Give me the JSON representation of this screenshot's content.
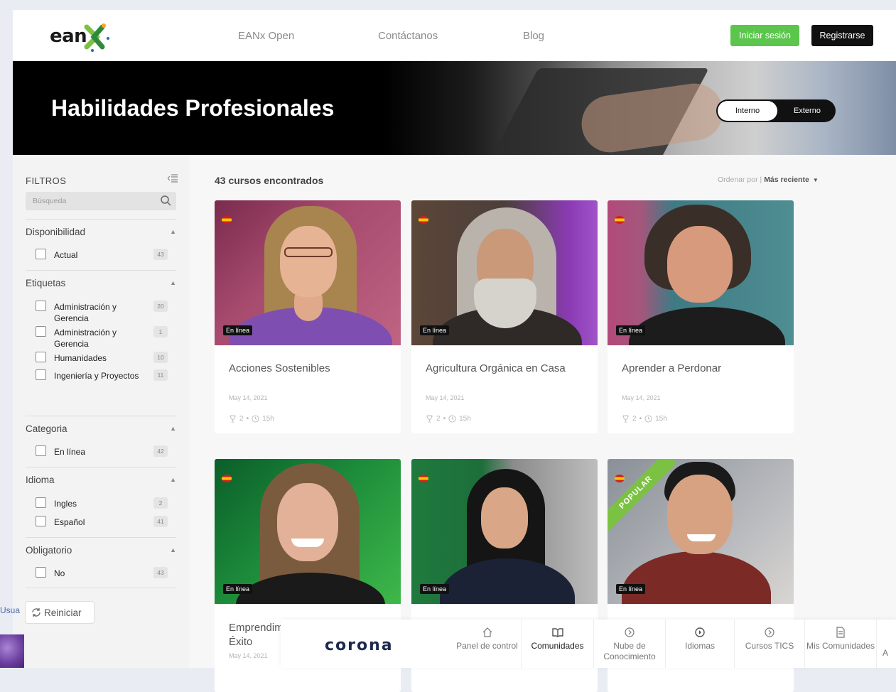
{
  "header": {
    "logo_text": "ean",
    "nav": [
      "EANx Open",
      "Contáctanos",
      "Blog"
    ],
    "login_label": "Iniciar sesión",
    "register_label": "Registrarse"
  },
  "hero": {
    "title": "Habilidades Profesionales",
    "toggle_active": "Interno",
    "toggle_inactive": "Externo"
  },
  "filters": {
    "title": "FILTROS",
    "search_placeholder": "Búsqueda",
    "sections": [
      {
        "title": "Disponibilidad",
        "options": [
          {
            "label": "Actual",
            "count": "43"
          }
        ]
      },
      {
        "title": "Etiquetas",
        "options": [
          {
            "label": "Administración y Gerencia",
            "count": "20"
          },
          {
            "label": "Administración y Gerencia",
            "count": "1"
          },
          {
            "label": "Humanidades",
            "count": "10"
          },
          {
            "label": "Ingeniería y Proyectos",
            "count": "11"
          }
        ]
      },
      {
        "title": "Categoria",
        "options": [
          {
            "label": "En línea",
            "count": "42"
          }
        ]
      },
      {
        "title": "Idioma",
        "options": [
          {
            "label": "Ingles",
            "count": "2"
          },
          {
            "label": "Español",
            "count": "41"
          }
        ]
      },
      {
        "title": "Obligatorio",
        "options": [
          {
            "label": "No",
            "count": "43"
          }
        ]
      }
    ],
    "reset_label": "Reiniciar"
  },
  "results": {
    "count_text": "43 cursos encontrados",
    "sort_prefix": "Ordenar por |",
    "sort_value": "Más reciente"
  },
  "courses": [
    {
      "title": "Acciones Sostenibles",
      "date": "May 14, 2021",
      "trophies": "2",
      "hours": "15h",
      "tag": "En línea"
    },
    {
      "title": "Agricultura Orgánica en Casa",
      "date": "May 14, 2021",
      "trophies": "2",
      "hours": "15h",
      "tag": "En línea"
    },
    {
      "title": "Aprender a Perdonar",
      "date": "May 14, 2021",
      "trophies": "2",
      "hours": "15h",
      "tag": "En línea"
    },
    {
      "title": "Emprendim Éxito",
      "date": "May 14, 2021",
      "tag": "En línea"
    },
    {
      "title": "",
      "date": "",
      "tag": "En línea"
    },
    {
      "title": "",
      "date": "",
      "tag": "En línea",
      "badge": "POPULAR"
    }
  ],
  "overlay": {
    "left_text": "Usua",
    "brand": "corona",
    "nav": [
      {
        "label": "Panel de control",
        "icon": "home-icon"
      },
      {
        "label": "Comunidades",
        "icon": "book-icon",
        "active": true
      },
      {
        "label": "Nube de Conocimiento",
        "icon": "play-circle-icon"
      },
      {
        "label": "Idiomas",
        "icon": "play-circle-icon"
      },
      {
        "label": "Cursos TICS",
        "icon": "play-circle-icon"
      },
      {
        "label": "Mis Comunidades",
        "icon": "document-icon"
      },
      {
        "label": "A",
        "icon": ""
      }
    ]
  },
  "colors": {
    "accent_green": "#5bc54c",
    "dark": "#111111",
    "popular_green": "#7cc242"
  }
}
